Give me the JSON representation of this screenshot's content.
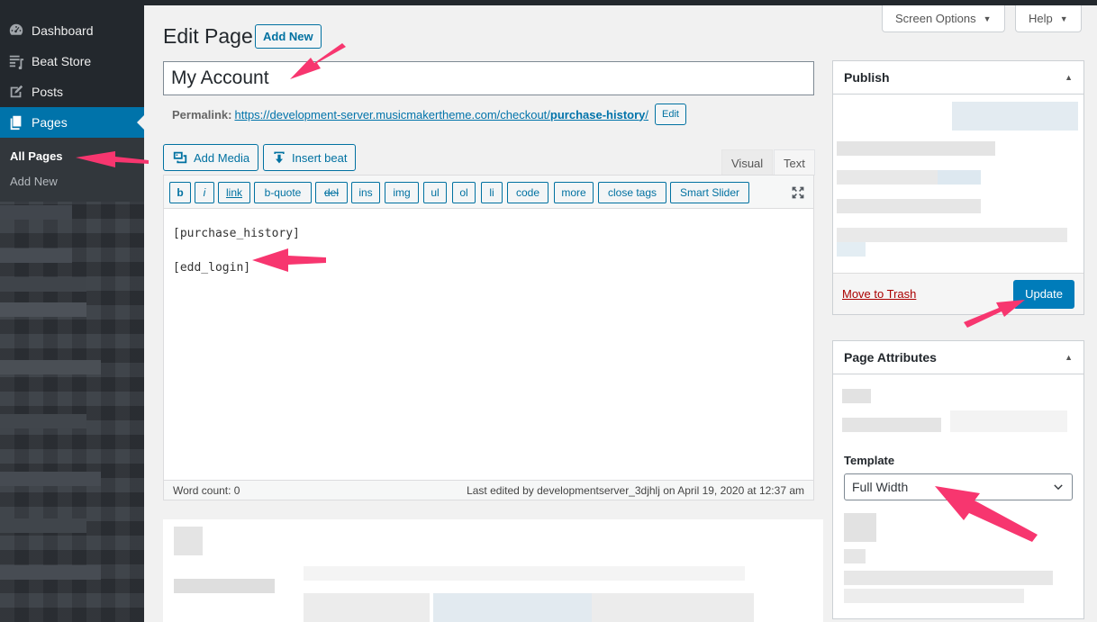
{
  "sidebar": {
    "items": [
      {
        "label": "Dashboard",
        "icon": "dashboard-icon"
      },
      {
        "label": "Beat Store",
        "icon": "playlist-icon"
      },
      {
        "label": "Posts",
        "icon": "pin-icon"
      },
      {
        "label": "Pages",
        "icon": "pages-icon"
      }
    ],
    "submenu": [
      "All Pages",
      "Add New"
    ]
  },
  "top_buttons": {
    "screen_options": "Screen Options",
    "help": "Help"
  },
  "header": {
    "title": "Edit Page",
    "add_new": "Add New"
  },
  "title_input": {
    "value": "My Account"
  },
  "permalink": {
    "label": "Permalink:",
    "url_prefix": "https://development-server.musicmakertheme.com/checkout/",
    "url_slug": "purchase-history",
    "url_suffix": "/",
    "edit": "Edit"
  },
  "media_buttons": {
    "add_media": "Add Media",
    "insert_beat": "Insert beat"
  },
  "editor_tabs": {
    "visual": "Visual",
    "text": "Text"
  },
  "quicktags": [
    "b",
    "i",
    "link",
    "b-quote",
    "del",
    "ins",
    "img",
    "ul",
    "ol",
    "li",
    "code",
    "more",
    "close tags",
    "Smart Slider"
  ],
  "editor": {
    "lines": [
      "[purchase_history]",
      "[edd_login]"
    ],
    "word_count": "Word count: 0",
    "last_edited": "Last edited by developmentserver_3djhlj on April 19, 2020 at 12:37 am"
  },
  "publish": {
    "title": "Publish",
    "trash": "Move to Trash",
    "update": "Update"
  },
  "page_attributes": {
    "title": "Page Attributes",
    "template_label": "Template",
    "template_value": "Full Width"
  },
  "colors": {
    "accent": "#0073aa",
    "sidebar_bg": "#23282d",
    "arrow": "#f7366f",
    "update": "#007cba"
  }
}
